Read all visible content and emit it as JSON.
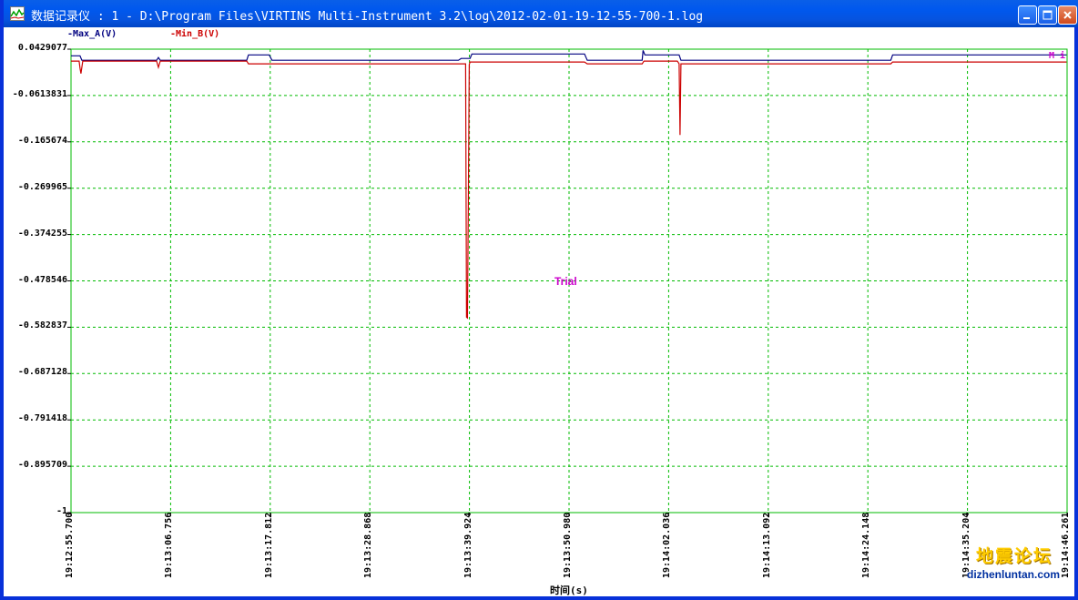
{
  "window": {
    "title": "数据记录仪 : 1 - D:\\Program Files\\VIRTINS Multi-Instrument 3.2\\log\\2012-02-01-19-12-55-700-1.log",
    "icon": "chart-app-icon",
    "controls": [
      "minimize",
      "maximize",
      "close"
    ]
  },
  "legend": {
    "series1": "-Max_A(V)",
    "series2": "-Min_B(V)",
    "series1_color": "#000080",
    "series2_color": "#cc0000"
  },
  "watermark": "Trial",
  "corner_mark": "M i",
  "site_logo": "地震论坛",
  "site_url": "dizhenluntan.com",
  "colors": {
    "grid": "#00bb00",
    "frame": "#00bb00",
    "background": "#ffffff"
  },
  "chart_data": {
    "type": "line",
    "xlabel": "时间(s)",
    "x_tick_labels": [
      "19:12:55.700",
      "19:13:06.756",
      "19:13:17.812",
      "19:13:28.868",
      "19:13:39.924",
      "19:13:50.980",
      "19:14:02.036",
      "19:14:13.092",
      "19:14:24.148",
      "19:14:35.204",
      "19:14:46.261"
    ],
    "xlim": [
      0,
      110.561
    ],
    "y_tick_labels": [
      "0.0429077",
      "-0.0613831",
      "-0.165674",
      "-0.269965",
      "-0.374255",
      "-0.478546",
      "-0.582837",
      "-0.687128",
      "-0.791418",
      "-0.895709",
      "-1"
    ],
    "ylim": [
      -1,
      0.0429077
    ],
    "grid": true,
    "legend_position": "top-left",
    "series": [
      {
        "name": "Max_A(V)",
        "color": "#000080",
        "points": [
          [
            0,
            0.028
          ],
          [
            1.0,
            0.028
          ],
          [
            1.2,
            0.018
          ],
          [
            9.5,
            0.018
          ],
          [
            9.7,
            0.024
          ],
          [
            9.9,
            0.018
          ],
          [
            19.5,
            0.018
          ],
          [
            19.7,
            0.03
          ],
          [
            22.0,
            0.03
          ],
          [
            22.3,
            0.018
          ],
          [
            43.0,
            0.018
          ],
          [
            43.3,
            0.022
          ],
          [
            44.3,
            0.022
          ],
          [
            44.5,
            0.032
          ],
          [
            57.0,
            0.032
          ],
          [
            57.3,
            0.018
          ],
          [
            63.4,
            0.018
          ],
          [
            63.5,
            0.04
          ],
          [
            63.7,
            0.03
          ],
          [
            67.5,
            0.03
          ],
          [
            67.7,
            0.018
          ],
          [
            91.0,
            0.018
          ],
          [
            91.2,
            0.03
          ],
          [
            110.5,
            0.03
          ]
        ]
      },
      {
        "name": "Min_B(V)",
        "color": "#cc0000",
        "points": [
          [
            0,
            0.016
          ],
          [
            0.9,
            0.016
          ],
          [
            1.0,
            0.0
          ],
          [
            1.1,
            -0.012
          ],
          [
            1.3,
            0.016
          ],
          [
            9.5,
            0.016
          ],
          [
            9.7,
            0.002
          ],
          [
            9.9,
            0.016
          ],
          [
            19.5,
            0.016
          ],
          [
            19.7,
            0.01
          ],
          [
            43.8,
            0.01
          ],
          [
            43.9,
            -0.56
          ],
          [
            44.0,
            -0.562
          ],
          [
            44.1,
            -0.3
          ],
          [
            44.2,
            0.008
          ],
          [
            44.3,
            0.014
          ],
          [
            57.0,
            0.014
          ],
          [
            57.3,
            0.01
          ],
          [
            63.4,
            0.01
          ],
          [
            63.6,
            0.016
          ],
          [
            67.3,
            0.016
          ],
          [
            67.5,
            0.01
          ],
          [
            67.6,
            -0.15
          ],
          [
            67.7,
            0.01
          ],
          [
            91.0,
            0.01
          ],
          [
            91.2,
            0.014
          ],
          [
            110.5,
            0.014
          ]
        ]
      }
    ]
  }
}
